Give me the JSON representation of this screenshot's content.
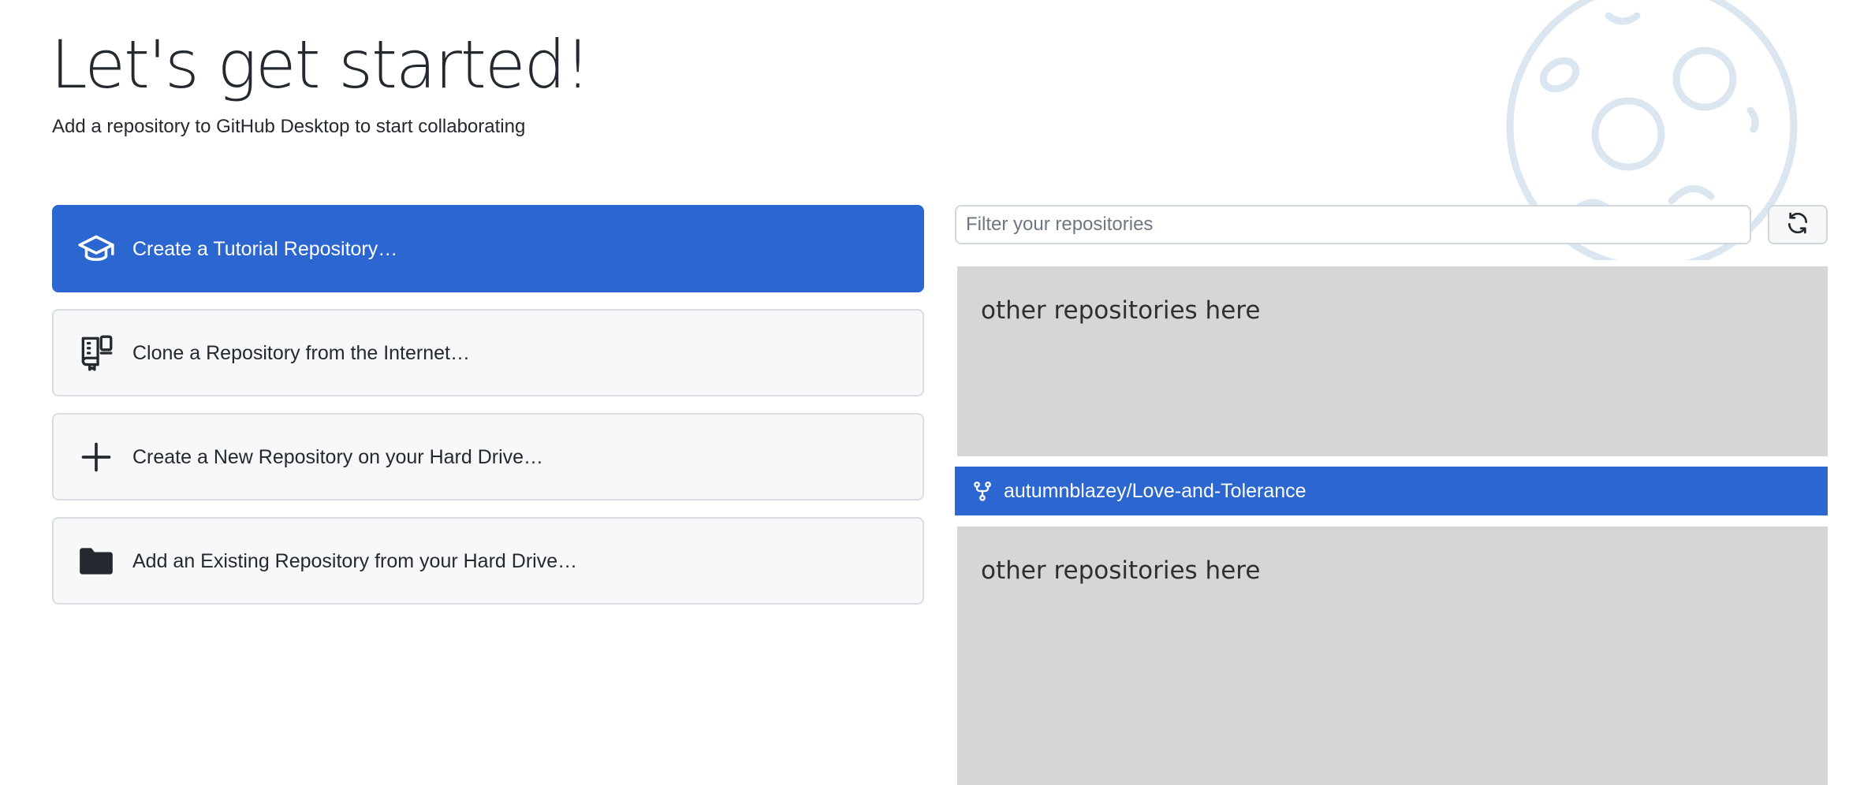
{
  "header": {
    "title": "Let's get started!",
    "subtitle": "Add a repository to GitHub Desktop to start collaborating"
  },
  "actions": [
    {
      "label": "Create a Tutorial Repository…",
      "icon": "graduation-cap-icon",
      "primary": true
    },
    {
      "label": "Clone a Repository from the Internet…",
      "icon": "repo-clone-icon",
      "primary": false
    },
    {
      "label": "Create a New Repository on your Hard Drive…",
      "icon": "plus-icon",
      "primary": false
    },
    {
      "label": "Add an Existing Repository from your Hard Drive…",
      "icon": "folder-icon",
      "primary": false
    }
  ],
  "repo_list": {
    "filter_placeholder": "Filter your repositories",
    "filter_value": "",
    "refresh_icon": "sync-icon",
    "placeholder_top": "other repositories here",
    "selected_repo": "autumnblazey/Love-and-Tolerance",
    "selected_repo_icon": "repo-forked-icon",
    "placeholder_bottom": "other repositories here"
  },
  "colors": {
    "accent": "#2b66d1",
    "placeholder_bg": "#d6d6d6",
    "button_bg": "#f6f8fa",
    "decoration": "#dce6f0"
  }
}
